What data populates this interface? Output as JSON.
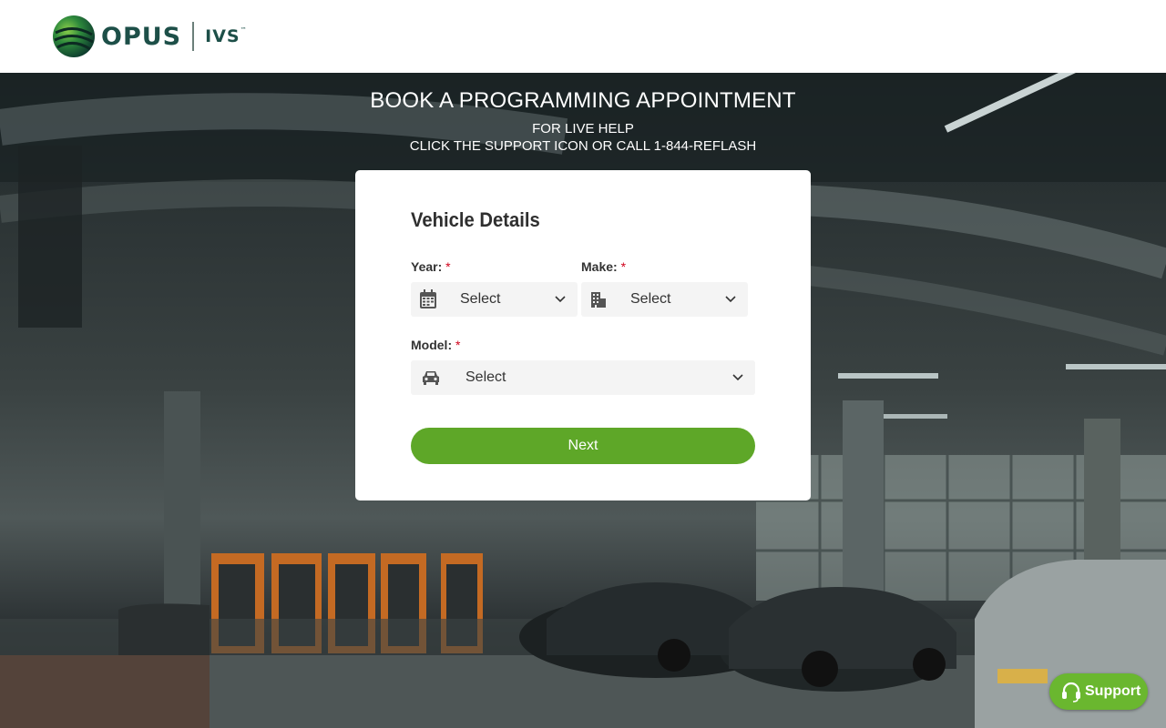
{
  "header": {
    "logo_text": "OPUS",
    "logo_sub": "IVS",
    "logo_tm": "™"
  },
  "hero": {
    "title": "BOOK A PROGRAMMING APPOINTMENT",
    "help_line1": "FOR LIVE HELP",
    "help_line2": "CLICK THE SUPPORT ICON OR CALL 1-844-REFLASH"
  },
  "form": {
    "title": "Vehicle Details",
    "year": {
      "label": "Year:",
      "required_mark": "*",
      "value": "Select",
      "icon": "calendar-icon"
    },
    "make": {
      "label": "Make:",
      "required_mark": "*",
      "value": "Select",
      "icon": "building-icon"
    },
    "model": {
      "label": "Model:",
      "required_mark": "*",
      "value": "Select",
      "icon": "car-icon"
    },
    "next_label": "Next"
  },
  "support": {
    "label": "Support",
    "icon": "headset-icon"
  },
  "colors": {
    "brand_green": "#5ea728",
    "logo_dark": "#1d4f48",
    "required": "#d0021b"
  }
}
